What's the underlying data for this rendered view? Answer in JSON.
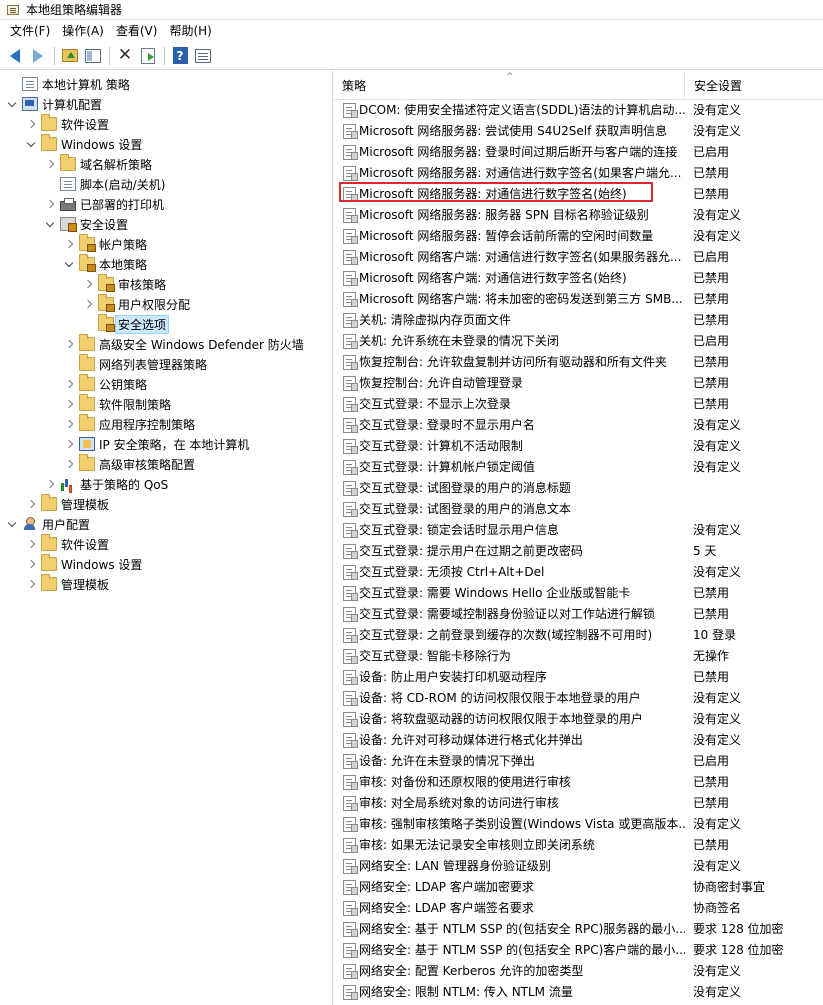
{
  "window": {
    "title": "本地组策略编辑器"
  },
  "menu": [
    "文件(F)",
    "操作(A)",
    "查看(V)",
    "帮助(H)"
  ],
  "tree": [
    {
      "label": "本地计算机 策略",
      "depth": 0,
      "twisty": "none",
      "icon": "doc"
    },
    {
      "label": "计算机配置",
      "depth": 0,
      "twisty": "open",
      "icon": "computer"
    },
    {
      "label": "软件设置",
      "depth": 1,
      "twisty": "closed",
      "icon": "folder"
    },
    {
      "label": "Windows 设置",
      "depth": 1,
      "twisty": "open",
      "icon": "folder"
    },
    {
      "label": "域名解析策略",
      "depth": 2,
      "twisty": "closed",
      "icon": "folder"
    },
    {
      "label": "脚本(启动/关机)",
      "depth": 2,
      "twisty": "none",
      "icon": "doc"
    },
    {
      "label": "已部署的打印机",
      "depth": 2,
      "twisty": "closed",
      "icon": "printer"
    },
    {
      "label": "安全设置",
      "depth": 2,
      "twisty": "open",
      "icon": "shield"
    },
    {
      "label": "帐户策略",
      "depth": 3,
      "twisty": "closed",
      "icon": "folder lock"
    },
    {
      "label": "本地策略",
      "depth": 3,
      "twisty": "open",
      "icon": "folder lock"
    },
    {
      "label": "审核策略",
      "depth": 4,
      "twisty": "closed",
      "icon": "folder lock"
    },
    {
      "label": "用户权限分配",
      "depth": 4,
      "twisty": "closed",
      "icon": "folder lock"
    },
    {
      "label": "安全选项",
      "depth": 4,
      "twisty": "none",
      "icon": "folder lock",
      "selected": true
    },
    {
      "label": "高级安全 Windows Defender 防火墙",
      "depth": 3,
      "twisty": "closed",
      "icon": "folder"
    },
    {
      "label": "网络列表管理器策略",
      "depth": 3,
      "twisty": "none",
      "icon": "folder"
    },
    {
      "label": "公钥策略",
      "depth": 3,
      "twisty": "closed",
      "icon": "folder"
    },
    {
      "label": "软件限制策略",
      "depth": 3,
      "twisty": "closed",
      "icon": "folder"
    },
    {
      "label": "应用程序控制策略",
      "depth": 3,
      "twisty": "closed",
      "icon": "folder"
    },
    {
      "label": "IP 安全策略，在 本地计算机",
      "depth": 3,
      "twisty": "closed",
      "icon": "monitor"
    },
    {
      "label": "高级审核策略配置",
      "depth": 3,
      "twisty": "closed",
      "icon": "folder"
    },
    {
      "label": "基于策略的 QoS",
      "depth": 2,
      "twisty": "closed",
      "icon": "chart"
    },
    {
      "label": "管理模板",
      "depth": 1,
      "twisty": "closed",
      "icon": "folder"
    },
    {
      "label": "用户配置",
      "depth": 0,
      "twisty": "open",
      "icon": "user"
    },
    {
      "label": "软件设置",
      "depth": 1,
      "twisty": "closed",
      "icon": "folder"
    },
    {
      "label": "Windows 设置",
      "depth": 1,
      "twisty": "closed",
      "icon": "folder"
    },
    {
      "label": "管理模板",
      "depth": 1,
      "twisty": "closed",
      "icon": "folder"
    }
  ],
  "list": {
    "columns": [
      "策略",
      "安全设置"
    ],
    "rows": [
      {
        "policy": "DCOM: 使用安全描述符定义语言(SDDL)语法的计算机启动...",
        "setting": "没有定义"
      },
      {
        "policy": "Microsoft 网络服务器: 尝试使用 S4U2Self 获取声明信息",
        "setting": "没有定义"
      },
      {
        "policy": "Microsoft 网络服务器: 登录时间过期后断开与客户端的连接",
        "setting": "已启用"
      },
      {
        "policy": "Microsoft 网络服务器: 对通信进行数字签名(如果客户端允...",
        "setting": "已禁用"
      },
      {
        "policy": "Microsoft 网络服务器: 对通信进行数字签名(始终)",
        "setting": "已禁用"
      },
      {
        "policy": "Microsoft 网络服务器: 服务器 SPN 目标名称验证级别",
        "setting": "没有定义"
      },
      {
        "policy": "Microsoft 网络服务器: 暂停会话前所需的空闲时间数量",
        "setting": "没有定义"
      },
      {
        "policy": "Microsoft 网络客户端: 对通信进行数字签名(如果服务器允...",
        "setting": "已启用"
      },
      {
        "policy": "Microsoft 网络客户端: 对通信进行数字签名(始终)",
        "setting": "已禁用"
      },
      {
        "policy": "Microsoft 网络客户端: 将未加密的密码发送到第三方 SMB...",
        "setting": "已禁用"
      },
      {
        "policy": "关机: 清除虚拟内存页面文件",
        "setting": "已禁用"
      },
      {
        "policy": "关机: 允许系统在未登录的情况下关闭",
        "setting": "已启用"
      },
      {
        "policy": "恢复控制台: 允许软盘复制并访问所有驱动器和所有文件夹",
        "setting": "已禁用"
      },
      {
        "policy": "恢复控制台: 允许自动管理登录",
        "setting": "已禁用"
      },
      {
        "policy": "交互式登录: 不显示上次登录",
        "setting": "已禁用"
      },
      {
        "policy": "交互式登录: 登录时不显示用户名",
        "setting": "没有定义"
      },
      {
        "policy": "交互式登录: 计算机不活动限制",
        "setting": "没有定义"
      },
      {
        "policy": "交互式登录: 计算机帐户锁定阈值",
        "setting": "没有定义"
      },
      {
        "policy": "交互式登录: 试图登录的用户的消息标题",
        "setting": ""
      },
      {
        "policy": "交互式登录: 试图登录的用户的消息文本",
        "setting": ""
      },
      {
        "policy": "交互式登录: 锁定会话时显示用户信息",
        "setting": "没有定义"
      },
      {
        "policy": "交互式登录: 提示用户在过期之前更改密码",
        "setting": "5 天"
      },
      {
        "policy": "交互式登录: 无须按 Ctrl+Alt+Del",
        "setting": "没有定义"
      },
      {
        "policy": "交互式登录: 需要 Windows Hello 企业版或智能卡",
        "setting": "已禁用"
      },
      {
        "policy": "交互式登录: 需要域控制器身份验证以对工作站进行解锁",
        "setting": "已禁用"
      },
      {
        "policy": "交互式登录: 之前登录到缓存的次数(域控制器不可用时)",
        "setting": "10 登录"
      },
      {
        "policy": "交互式登录: 智能卡移除行为",
        "setting": "无操作"
      },
      {
        "policy": "设备: 防止用户安装打印机驱动程序",
        "setting": "已禁用"
      },
      {
        "policy": "设备: 将 CD-ROM 的访问权限仅限于本地登录的用户",
        "setting": "没有定义"
      },
      {
        "policy": "设备: 将软盘驱动器的访问权限仅限于本地登录的用户",
        "setting": "没有定义"
      },
      {
        "policy": "设备: 允许对可移动媒体进行格式化并弹出",
        "setting": "没有定义"
      },
      {
        "policy": "设备: 允许在未登录的情况下弹出",
        "setting": "已启用"
      },
      {
        "policy": "审核: 对备份和还原权限的使用进行审核",
        "setting": "已禁用"
      },
      {
        "policy": "审核: 对全局系统对象的访问进行审核",
        "setting": "已禁用"
      },
      {
        "policy": "审核: 强制审核策略子类别设置(Windows Vista 或更高版本...",
        "setting": "没有定义"
      },
      {
        "policy": "审核: 如果无法记录安全审核则立即关闭系统",
        "setting": "已禁用"
      },
      {
        "policy": "网络安全: LAN 管理器身份验证级别",
        "setting": "没有定义"
      },
      {
        "policy": "网络安全: LDAP 客户端加密要求",
        "setting": "协商密封事宜"
      },
      {
        "policy": "网络安全: LDAP 客户端签名要求",
        "setting": "协商签名"
      },
      {
        "policy": "网络安全: 基于 NTLM SSP 的(包括安全 RPC)服务器的最小...",
        "setting": "要求 128 位加密"
      },
      {
        "policy": "网络安全: 基于 NTLM SSP 的(包括安全 RPC)客户端的最小...",
        "setting": "要求 128 位加密"
      },
      {
        "policy": "网络安全: 配置 Kerberos 允许的加密类型",
        "setting": "没有定义"
      },
      {
        "policy": "网络安全: 限制 NTLM: 传入 NTLM 流量",
        "setting": "没有定义"
      }
    ]
  }
}
